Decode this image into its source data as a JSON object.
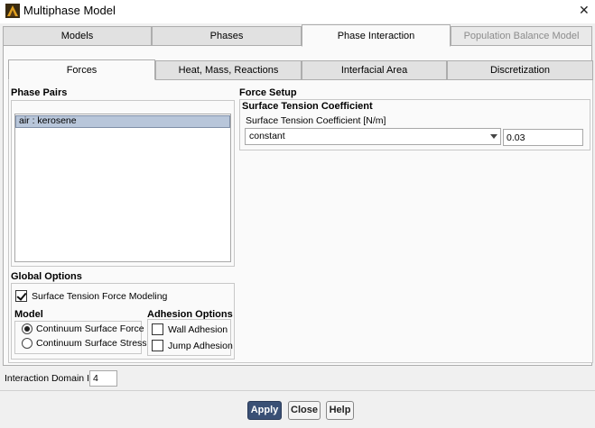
{
  "window": {
    "title": "Multiphase Model"
  },
  "main_tabs": [
    {
      "label": "Models"
    },
    {
      "label": "Phases"
    },
    {
      "label": "Phase Interaction"
    },
    {
      "label": "Population Balance Model"
    }
  ],
  "sub_tabs": [
    {
      "label": "Forces"
    },
    {
      "label": "Heat, Mass, Reactions"
    },
    {
      "label": "Interfacial Area"
    },
    {
      "label": "Discretization"
    }
  ],
  "phase_pairs": {
    "title": "Phase Pairs",
    "items": [
      "air : kerosene"
    ]
  },
  "force_setup": {
    "title": "Force Setup",
    "group_title": "Surface Tension Coefficient",
    "field_label": "Surface Tension Coefficient [N/m]",
    "method": "constant",
    "value": "0.03"
  },
  "global_options": {
    "title": "Global Options",
    "surface_tension_label": "Surface Tension Force Modeling",
    "model_title": "Model",
    "model_options": [
      "Continuum Surface Force",
      "Continuum Surface Stress"
    ],
    "adhesion_title": "Adhesion Options",
    "adhesion_options": [
      "Wall Adhesion",
      "Jump Adhesion"
    ]
  },
  "interaction_domain": {
    "label": "Interaction Domain ID",
    "value": "4"
  },
  "buttons": {
    "apply": "Apply",
    "close": "Close",
    "help": "Help"
  },
  "colors": {
    "primary_button": "#3a5075",
    "list_selection": "#b8c6da"
  }
}
